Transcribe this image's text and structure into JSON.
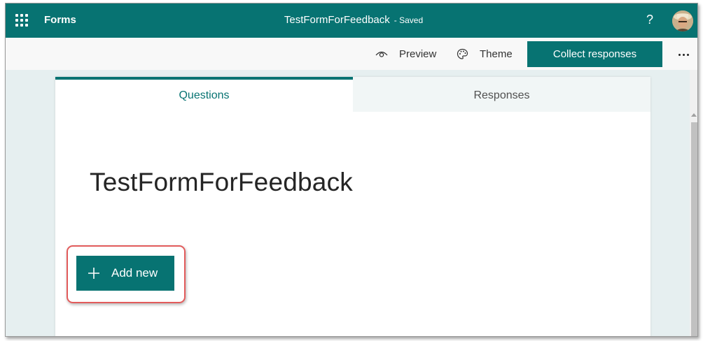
{
  "appbar": {
    "app_name": "Forms",
    "doc_title": "TestFormForFeedback",
    "doc_status": "- Saved",
    "help_label": "?",
    "icons": {
      "launcher": "app-launcher-icon",
      "avatar": "user-avatar"
    }
  },
  "commandbar": {
    "preview_label": "Preview",
    "theme_label": "Theme",
    "collect_label": "Collect responses",
    "icons": {
      "preview": "eye-icon",
      "theme": "palette-icon",
      "more": "more-options-icon"
    }
  },
  "tabs": [
    {
      "label": "Questions",
      "active": true
    },
    {
      "label": "Responses",
      "active": false
    }
  ],
  "form": {
    "title": "TestFormForFeedback",
    "add_new_label": "Add new"
  },
  "colors": {
    "brand": "#077372",
    "highlight": "#e25b5b",
    "background": "#e6eff0"
  }
}
